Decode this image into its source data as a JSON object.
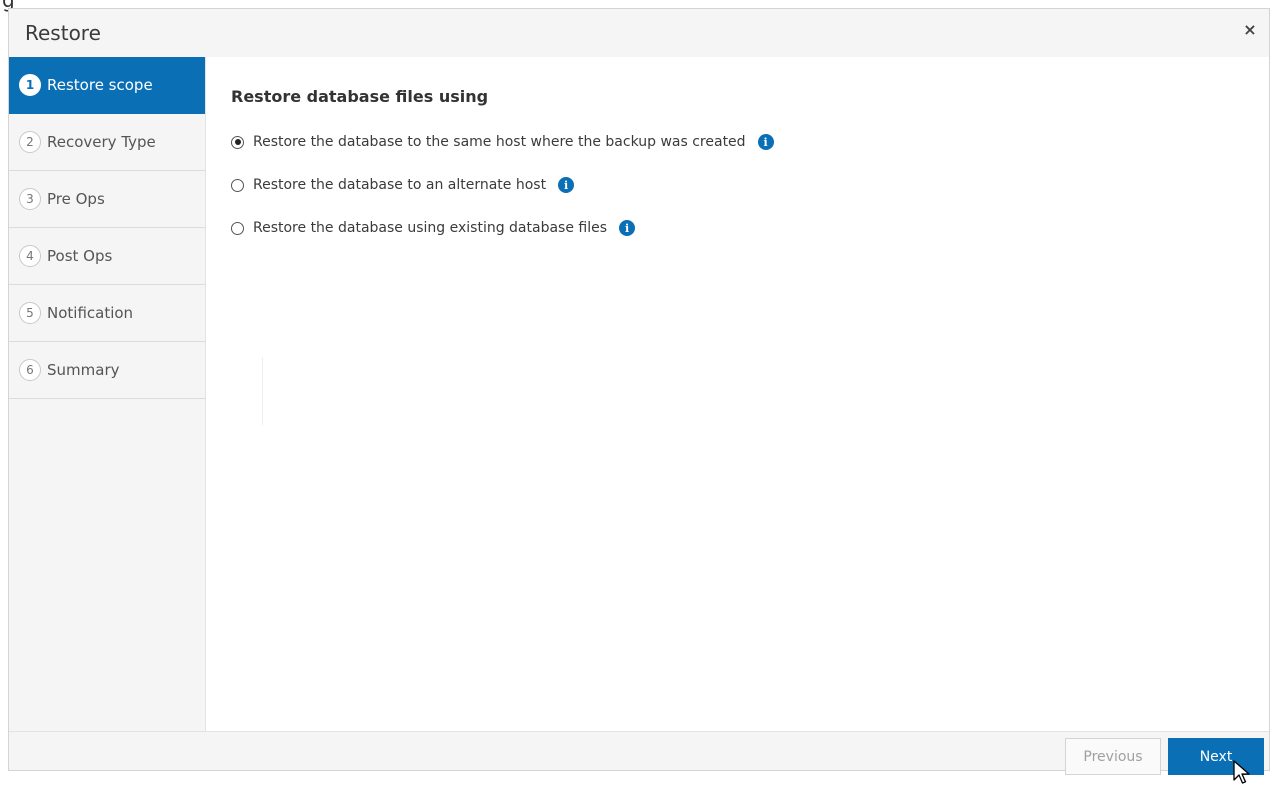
{
  "top_glyph": "g",
  "dialog": {
    "title": "Restore",
    "close_label": "×"
  },
  "steps": [
    {
      "number": "1",
      "label": "Restore scope",
      "active": true
    },
    {
      "number": "2",
      "label": "Recovery Type",
      "active": false
    },
    {
      "number": "3",
      "label": "Pre Ops",
      "active": false
    },
    {
      "number": "4",
      "label": "Post Ops",
      "active": false
    },
    {
      "number": "5",
      "label": "Notification",
      "active": false
    },
    {
      "number": "6",
      "label": "Summary",
      "active": false
    }
  ],
  "content": {
    "heading": "Restore database files using",
    "options": [
      {
        "label": "Restore the database to the same host where the backup was created",
        "checked": true,
        "info_icon": "info-icon"
      },
      {
        "label": "Restore the database to an alternate host",
        "checked": false,
        "info_icon": "info-icon"
      },
      {
        "label": "Restore the database using existing database files",
        "checked": false,
        "info_icon": "info-icon"
      }
    ]
  },
  "footer": {
    "previous_label": "Previous",
    "next_label": "Next"
  },
  "colors": {
    "accent": "#0a6fb5",
    "panel_bg": "#f5f5f5"
  }
}
